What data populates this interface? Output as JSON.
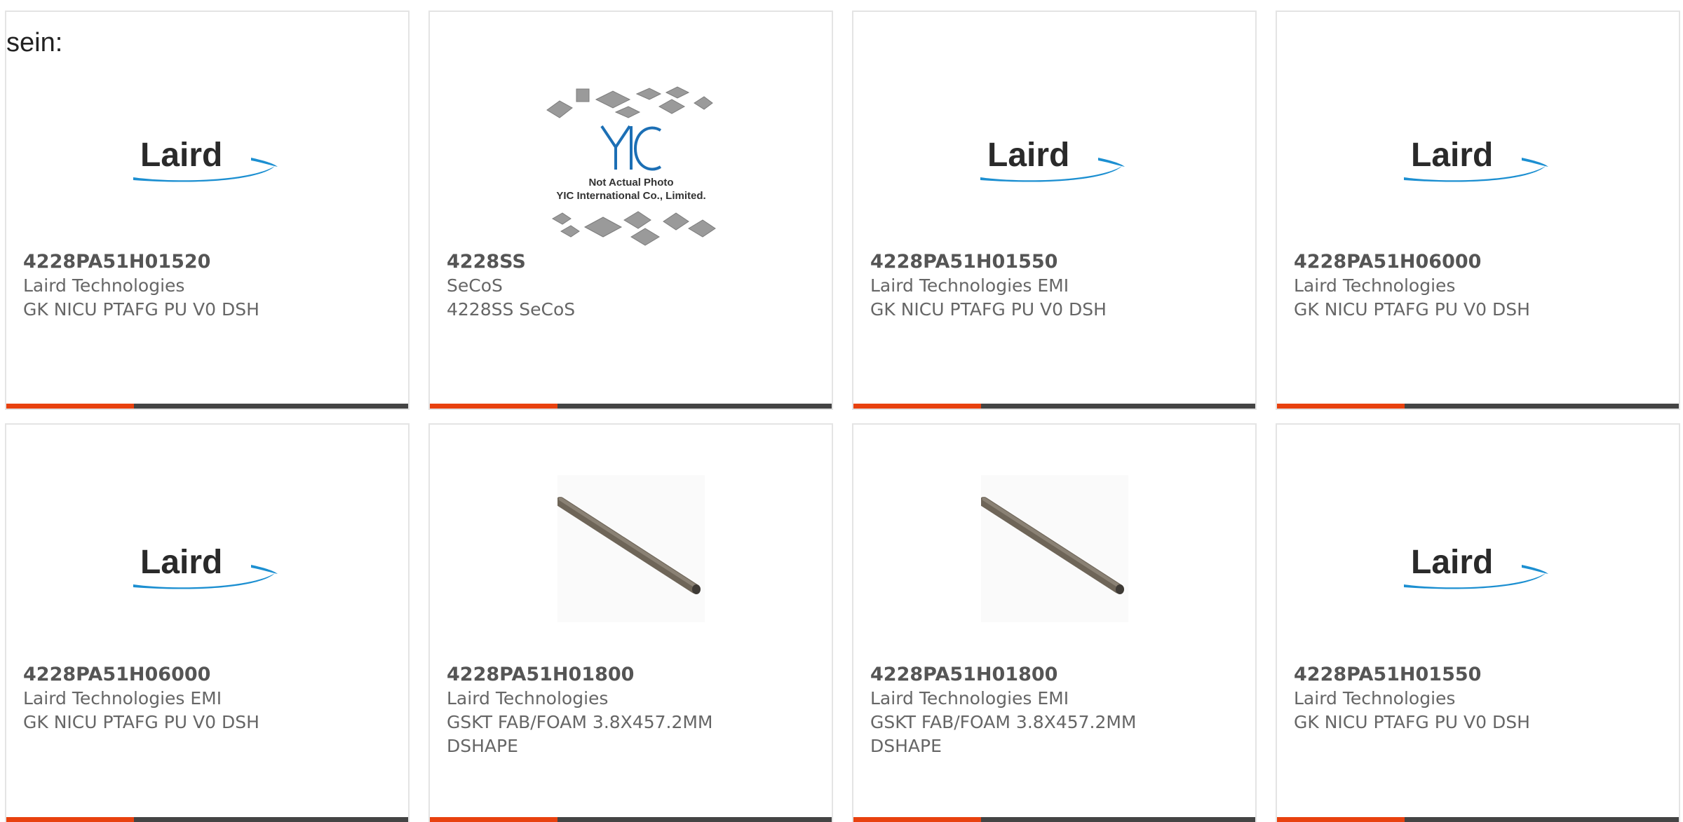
{
  "lead_text": "sein:",
  "colors": {
    "accent": "#e8410f",
    "bar": "#444444",
    "border": "#e4e4e4",
    "laird_blue": "#1c8fd1"
  },
  "products": [
    {
      "part_number": "4228PA51H01520",
      "manufacturer": "Laird Technologies",
      "description": "GK NICU PTAFG PU V0 DSH",
      "image": "laird-logo"
    },
    {
      "part_number": "4228SS",
      "manufacturer": "SeCoS",
      "description": "4228SS SeCoS",
      "image": "yic-placeholder",
      "image_text": {
        "brand": "YIC",
        "line1": "Not Actual Photo",
        "line2": "YIC International Co., Limited."
      }
    },
    {
      "part_number": "4228PA51H01550",
      "manufacturer": "Laird Technologies EMI",
      "description": "GK NICU PTAFG PU V0 DSH",
      "image": "laird-logo"
    },
    {
      "part_number": "4228PA51H06000",
      "manufacturer": "Laird Technologies",
      "description": "GK NICU PTAFG PU V0 DSH",
      "image": "laird-logo"
    },
    {
      "part_number": "4228PA51H06000",
      "manufacturer": "Laird Technologies EMI",
      "description": "GK NICU PTAFG PU V0 DSH",
      "image": "laird-logo"
    },
    {
      "part_number": "4228PA51H01800",
      "manufacturer": "Laird Technologies",
      "description": "GSKT FAB/FOAM 3.8X457.2MM DSHAPE",
      "image": "gasket-rod-photo"
    },
    {
      "part_number": "4228PA51H01800",
      "manufacturer": "Laird Technologies EMI",
      "description": "GSKT FAB/FOAM 3.8X457.2MM DSHAPE",
      "image": "gasket-rod-photo"
    },
    {
      "part_number": "4228PA51H01550",
      "manufacturer": "Laird Technologies",
      "description": "GK NICU PTAFG PU V0 DSH",
      "image": "laird-logo"
    }
  ],
  "logo_text": "Laird"
}
